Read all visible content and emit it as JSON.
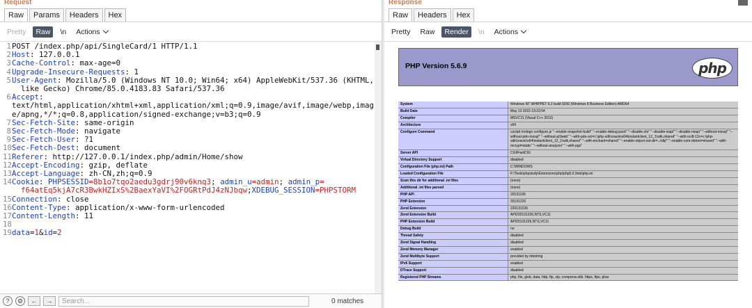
{
  "request": {
    "title": "Request",
    "tabs": [
      "Raw",
      "Params",
      "Headers",
      "Hex"
    ],
    "toolbar": {
      "pretty": "Pretty",
      "raw": "Raw",
      "newline": "\\n",
      "actions": "Actions"
    },
    "lines": [
      {
        "n": "1",
        "parts": [
          {
            "t": "POST /index.php/api/SingleCard/1 HTTP/1.1",
            "c": ""
          }
        ]
      },
      {
        "n": "2",
        "parts": [
          {
            "t": "Host",
            "c": "kw"
          },
          {
            "t": ": 127.0.0.1",
            "c": ""
          }
        ]
      },
      {
        "n": "3",
        "parts": [
          {
            "t": "Cache-Control",
            "c": "kw"
          },
          {
            "t": ": max-age=0",
            "c": ""
          }
        ]
      },
      {
        "n": "4",
        "parts": [
          {
            "t": "Upgrade-Insecure-Requests",
            "c": "kw"
          },
          {
            "t": ": 1",
            "c": ""
          }
        ]
      },
      {
        "n": "5",
        "parts": [
          {
            "t": "User-Agent",
            "c": "kw"
          },
          {
            "t": ": Mozilla/5.0 (Windows NT 10.0; Win64; x64) AppleWebKit/537.36 (KHTML,",
            "c": ""
          }
        ]
      },
      {
        "n": "",
        "cont": true,
        "parts": [
          {
            "t": "like Gecko) Chrome/85.0.4183.83 Safari/537.36",
            "c": ""
          }
        ]
      },
      {
        "n": "6",
        "parts": [
          {
            "t": "Accept",
            "c": "kw"
          },
          {
            "t": ":",
            "c": ""
          }
        ]
      },
      {
        "n": "",
        "cont": true,
        "flush": true,
        "parts": [
          {
            "t": "text/html,application/xhtml+xml,application/xml;q=0.9,image/avif,image/webp,imag",
            "c": ""
          }
        ]
      },
      {
        "n": "",
        "cont": true,
        "flush": true,
        "parts": [
          {
            "t": "e/apng,*/*;q=0.8,application/signed-exchange;v=b3;q=0.9",
            "c": ""
          }
        ]
      },
      {
        "n": "7",
        "parts": [
          {
            "t": "Sec-Fetch-Site",
            "c": "kw"
          },
          {
            "t": ": same-origin",
            "c": ""
          }
        ]
      },
      {
        "n": "8",
        "parts": [
          {
            "t": "Sec-Fetch-Mode",
            "c": "kw"
          },
          {
            "t": ": navigate",
            "c": ""
          }
        ]
      },
      {
        "n": "9",
        "parts": [
          {
            "t": "Sec-Fetch-User",
            "c": "kw"
          },
          {
            "t": ": ?1",
            "c": ""
          }
        ]
      },
      {
        "n": "10",
        "parts": [
          {
            "t": "Sec-Fetch-Dest",
            "c": "kw"
          },
          {
            "t": ": document",
            "c": ""
          }
        ]
      },
      {
        "n": "11",
        "parts": [
          {
            "t": "Referer",
            "c": "kw"
          },
          {
            "t": ": http://127.0.0.1/index.php/admin/Home/show",
            "c": ""
          }
        ]
      },
      {
        "n": "12",
        "parts": [
          {
            "t": "Accept-Encoding",
            "c": "kw"
          },
          {
            "t": ": gzip, deflate",
            "c": ""
          }
        ]
      },
      {
        "n": "13",
        "parts": [
          {
            "t": "Accept-Language",
            "c": "kw"
          },
          {
            "t": ": zh-CN,zh;q=0.9",
            "c": ""
          }
        ]
      },
      {
        "n": "14",
        "parts": [
          {
            "t": "Cookie",
            "c": "kw"
          },
          {
            "t": ": ",
            "c": ""
          },
          {
            "t": "PHPSESSID",
            "c": "kw"
          },
          {
            "t": "=8b1o7tqo2aedu3gdrj90v6knq3",
            "c": "red"
          },
          {
            "t": "; ",
            "c": ""
          },
          {
            "t": "admin_u",
            "c": "kw"
          },
          {
            "t": "=admin",
            "c": "red"
          },
          {
            "t": "; ",
            "c": ""
          },
          {
            "t": "admin_p",
            "c": "kw"
          },
          {
            "t": "=",
            "c": "red"
          }
        ]
      },
      {
        "n": "",
        "cont": true,
        "parts": [
          {
            "t": "f64atEq5kjA7cR3BwkHZIxS%2BaexYaVI%2FOGRtPdJ4zNJbqw",
            "c": "red"
          },
          {
            "t": ";",
            "c": ""
          },
          {
            "t": "XDEBUG_SESSION",
            "c": "kw"
          },
          {
            "t": "=PHPSTORM",
            "c": "red"
          }
        ]
      },
      {
        "n": "15",
        "parts": [
          {
            "t": "Connection",
            "c": "kw"
          },
          {
            "t": ": close",
            "c": ""
          }
        ]
      },
      {
        "n": "16",
        "parts": [
          {
            "t": "Content-Type",
            "c": "kw"
          },
          {
            "t": ": application/x-www-form-urlencoded",
            "c": ""
          }
        ]
      },
      {
        "n": "17",
        "parts": [
          {
            "t": "Content-Length",
            "c": "kw"
          },
          {
            "t": ": 11",
            "c": ""
          }
        ]
      },
      {
        "n": "18",
        "parts": [
          {
            "t": "",
            "c": ""
          }
        ]
      },
      {
        "n": "19",
        "parts": [
          {
            "t": "data",
            "c": "kw"
          },
          {
            "t": "=",
            "c": ""
          },
          {
            "t": "1",
            "c": "red"
          },
          {
            "t": "&",
            "c": ""
          },
          {
            "t": "id",
            "c": "kw"
          },
          {
            "t": "=",
            "c": ""
          },
          {
            "t": "2",
            "c": "red"
          }
        ]
      }
    ],
    "footer": {
      "search_placeholder": "Search...",
      "matches": "0 matches"
    }
  },
  "response": {
    "title": "Response",
    "tabs": [
      "Raw",
      "Headers",
      "Hex"
    ],
    "toolbar": {
      "pretty": "Pretty",
      "raw": "Raw",
      "render": "Render",
      "newline": "\\n",
      "actions": "Actions"
    },
    "php": {
      "version": "PHP Version 5.6.9",
      "logo": "php",
      "rows": [
        [
          "System",
          "Windows NT WHIPPET 6.2 build 9200 (Windows 8 Business Edition) AMD64"
        ],
        [
          "Build Date",
          "May 13 2015 19:23:54"
        ],
        [
          "Compiler",
          "MSVC11 (Visual C++ 2012)"
        ],
        [
          "Architecture",
          "x64"
        ],
        [
          "Configure Command",
          "cscript /nologo configure.js \"--enable-snapshot-build\" \"--enable-debug-pack\" \"--disable-zts\" \"--disable-isapi\" \"--disable-nsapi\" \"--without-mssql\" \"--without-pdo-mssql\" \"--without-pi3web\" \"--with-pdo-oci=c:\\php-sdk\\oracle\\x64\\instantclient_12_1\\sdk,shared\" \"--with-oci8-12c=c:\\php-sdk\\oracle\\x64\\instantclient_12_1\\sdk,shared\" \"--with-enchant=shared\" \"--enable-object-out-dir=../obj/\" \"--enable-com-dotnet=shared\" \"--with-mcrypt=static\" \"--without-analyzer\" \"--with-pgo\""
        ],
        [
          "Server API",
          "CGI/FastCGI"
        ],
        [
          "Virtual Directory Support",
          "disabled"
        ],
        [
          "Configuration File (php.ini) Path",
          "C:\\WINDOWS"
        ],
        [
          "Loaded Configuration File",
          "F:\\Tools\\phpstudy\\Extensions\\php\\php5.6.9nts\\php.ini"
        ],
        [
          "Scan this dir for additional .ini files",
          "(none)"
        ],
        [
          "Additional .ini files parsed",
          "(none)"
        ],
        [
          "PHP API",
          "20131106"
        ],
        [
          "PHP Extension",
          "20131226"
        ],
        [
          "Zend Extension",
          "220131226"
        ],
        [
          "Zend Extension Build",
          "API220131226,NTS,VC11"
        ],
        [
          "PHP Extension Build",
          "API20131226,NTS,VC11"
        ],
        [
          "Debug Build",
          "no"
        ],
        [
          "Thread Safety",
          "disabled"
        ],
        [
          "Zend Signal Handling",
          "disabled"
        ],
        [
          "Zend Memory Manager",
          "enabled"
        ],
        [
          "Zend Multibyte Support",
          "provided by mbstring"
        ],
        [
          "IPv6 Support",
          "enabled"
        ],
        [
          "DTrace Support",
          "disabled"
        ],
        [
          "Registered PHP Streams",
          "php, file, glob, data, http, ftp, zip, compress.zlib, https, ftps, phar"
        ]
      ]
    }
  },
  "colors": {
    "keyword": "#1d3fbf",
    "value": "#cc2020",
    "php_header": "#9999cc",
    "php_key": "#ccccff",
    "php_value": "#cccccc",
    "title": "#e8743b"
  }
}
